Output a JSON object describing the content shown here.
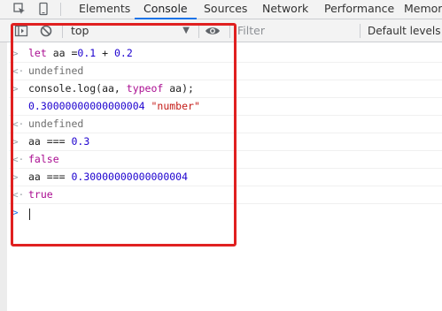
{
  "tabs": [
    {
      "label": "Elements"
    },
    {
      "label": "Console",
      "active": true
    },
    {
      "label": "Sources"
    },
    {
      "label": "Network"
    },
    {
      "label": "Performance"
    },
    {
      "label": "Memor"
    }
  ],
  "toolbar": {
    "context_value": "top",
    "filter_placeholder": "Filter",
    "levels_label": "Default levels"
  },
  "console": {
    "line1": {
      "kw": "let",
      "rest1": " aa =",
      "num1": "0.1",
      "mid": " + ",
      "num2": "0.2"
    },
    "line2": {
      "text": "undefined"
    },
    "line3": {
      "a": "console.log(aa, ",
      "kw": "typeof",
      "b": " aa);"
    },
    "line4": {
      "num": "0.30000000000000004",
      "str": " \"number\""
    },
    "line5": {
      "text": "undefined"
    },
    "line6": {
      "a": "aa ",
      "op": "===",
      "num": " 0.3"
    },
    "line7": {
      "text": "false"
    },
    "line8": {
      "a": "aa ",
      "op": "===",
      "num": " 0.30000000000000004"
    },
    "line9": {
      "text": "true"
    }
  },
  "colors": {
    "highlight_border": "#e02020",
    "active_tab_underline": "#1a73e8",
    "keyword": "#aa0d91",
    "number": "#1c00cf",
    "string": "#c41a16"
  }
}
